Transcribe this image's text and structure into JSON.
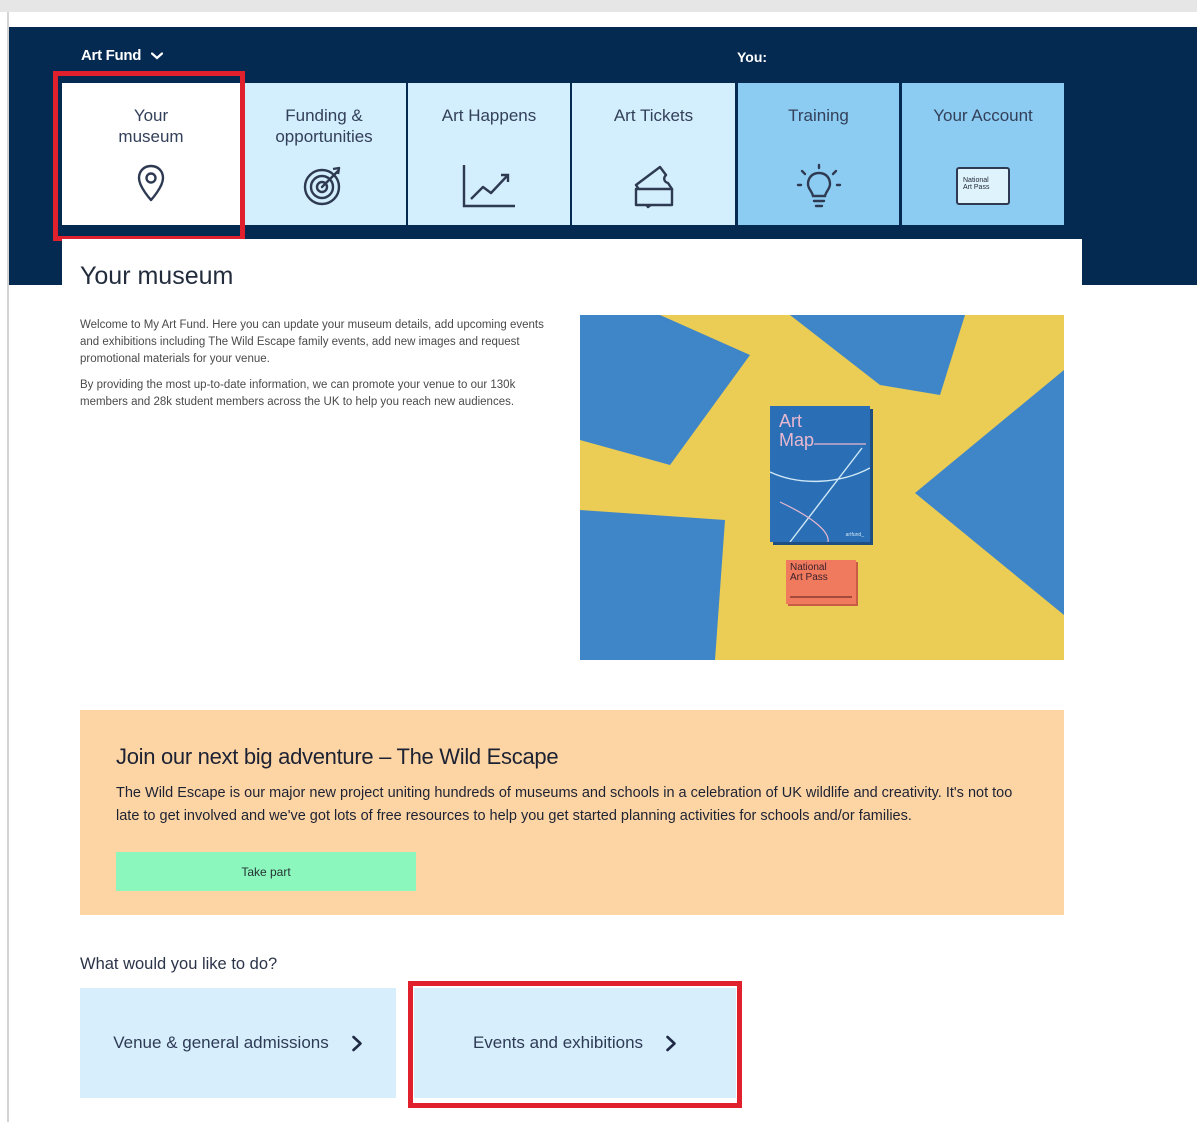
{
  "header": {
    "brand": "Art Fund",
    "you_label": "You:"
  },
  "nav": {
    "tiles": [
      {
        "label": "Your museum",
        "icon": "map-pin-icon",
        "active": true
      },
      {
        "label": "Funding & opportunities",
        "icon": "target-icon"
      },
      {
        "label": "Art Happens",
        "icon": "chart-growth-icon"
      },
      {
        "label": "Art Tickets",
        "icon": "ticket-icon"
      },
      {
        "label": "Training",
        "icon": "lightbulb-icon"
      },
      {
        "label": "Your Account",
        "icon": "national-art-pass-card-icon",
        "card_text": "National Art Pass"
      }
    ]
  },
  "page": {
    "title": "Your museum",
    "intro": [
      "Welcome to My Art Fund. Here you can update your museum details, add upcoming events and exhibitions including The Wild Escape family events, add new images and request promotional materials for your venue.",
      "By providing the most up-to-date information, we can promote your venue to our 130k members and 28k student members across the UK to help you reach new audiences."
    ],
    "hero": {
      "book_title": "Art Map",
      "book_footer": "artfund_",
      "pass_title": "National Art Pass"
    }
  },
  "banner": {
    "title": "Join our next big adventure – The Wild Escape",
    "description": "The Wild Escape is our major new project uniting hundreds of museums and schools in a celebration of UK wildlife and creativity. It's not too late to get involved and we've got lots of free resources to help you get started planning activities for schools and/or families.",
    "button": "Take part"
  },
  "actions": {
    "heading": "What would you like to do?",
    "items": [
      {
        "label": "Venue & general admissions"
      },
      {
        "label": "Events and exhibitions"
      }
    ]
  },
  "colors": {
    "navy": "#052a52",
    "tile_light": "#d3eefc",
    "tile_dark": "#8dccf2",
    "banner": "#fdd5a5",
    "button": "#8cf7bd",
    "highlight": "#e0202c",
    "hero_yellow": "#ebcc55",
    "hero_blue": "#3f86c8"
  }
}
